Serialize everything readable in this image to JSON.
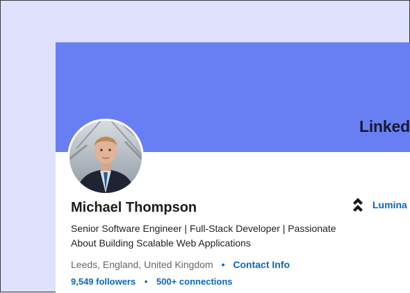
{
  "brand": {
    "text": "LinkedIn",
    "banner_color": "#687ff4"
  },
  "profile": {
    "name": "Michael Thompson",
    "headline": "Senior Software Engineer | Full-Stack Developer | Passionate About Building Scalable Web Applications",
    "location": "Leeds, England, United Kingdom",
    "separator": "•",
    "contact_label": "Contact Info",
    "followers": "9,549 followers",
    "connections": "500+ connections",
    "avatar_icon": "profile-photo"
  },
  "company": {
    "name": "Lumina",
    "icon": "company-logo-icon"
  },
  "colors": {
    "link": "#0a66c2",
    "page_background": "#dfe1fd"
  }
}
